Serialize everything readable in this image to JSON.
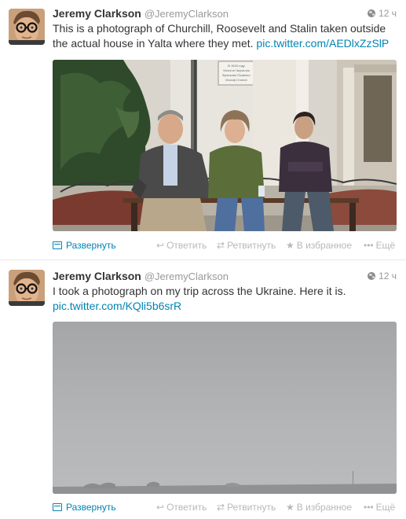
{
  "tweets": [
    {
      "author_name": "Jeremy Clarkson",
      "author_handle": "@JeremyClarkson",
      "time": "12 ч",
      "text": "This is a photograph of Churchill, Roosevelt and Stalin taken outside the actual house in Yalta where they met.",
      "link": "pic.twitter.com/AEDlxZzSlP",
      "media_icon": "photo-yalta-house",
      "plaque_lines": [
        "В 1945 году",
        "Уинстон Черчилль",
        "Франклин Рузвельт",
        "Иосиф Сталин"
      ]
    },
    {
      "author_name": "Jeremy Clarkson",
      "author_handle": "@JeremyClarkson",
      "time": "12 ч",
      "text": "I took a photograph on my trip across the Ukraine. Here it is.",
      "link": "pic.twitter.com/KQli5b6srR",
      "media_icon": "photo-foggy-landscape"
    }
  ],
  "actions": {
    "expand": "Развернуть",
    "reply": "Ответить",
    "retweet": "Ретвитнуть",
    "favorite": "В избранное",
    "more": "Ещё"
  },
  "icons": {
    "expand": "photo-card-icon",
    "reply": "reply-arrow-icon",
    "retweet": "retweet-icon",
    "favorite": "star-icon",
    "more": "dots-icon",
    "privacy": "globe-icon"
  },
  "colors": {
    "link": "#0084b4",
    "muted": "#999999",
    "action": "#b8b8b8",
    "text": "#333333"
  }
}
